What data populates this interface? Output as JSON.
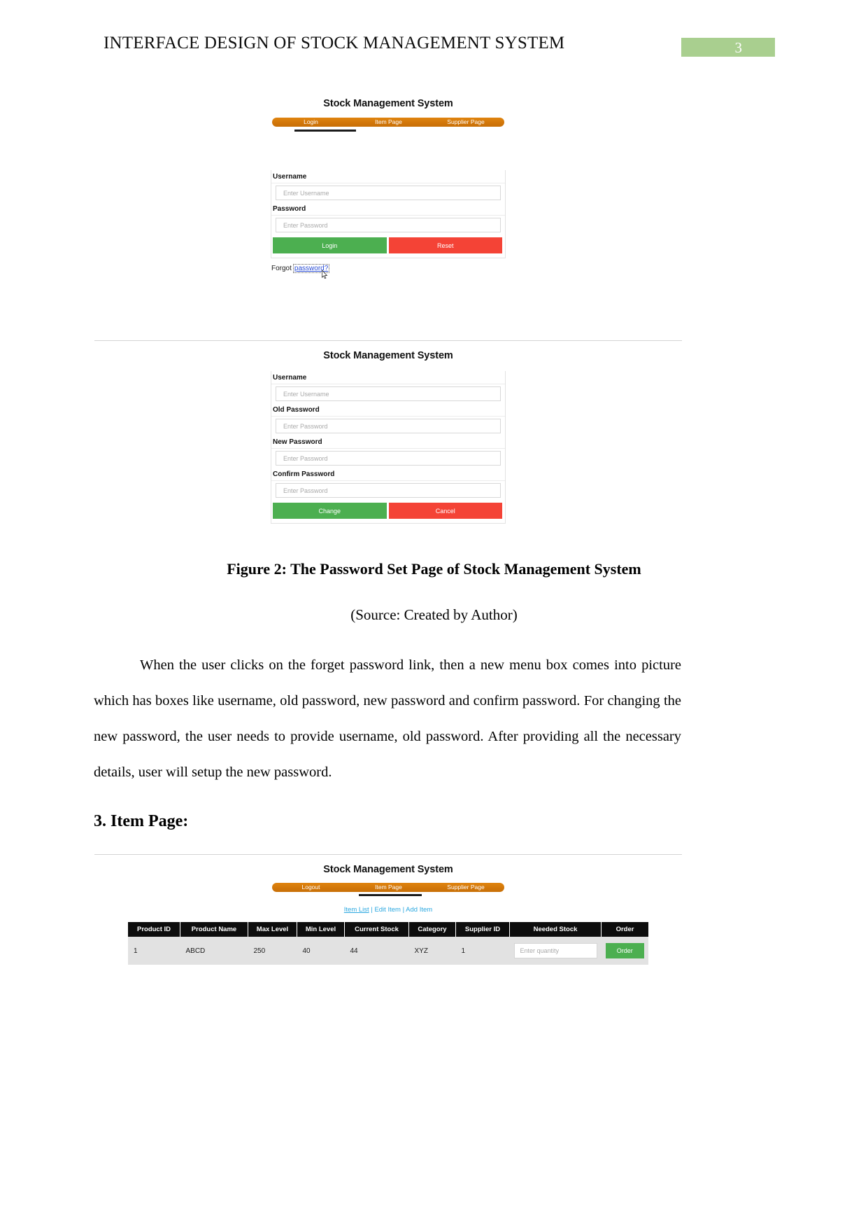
{
  "document": {
    "header_title": "INTERFACE DESIGN OF STOCK MANAGEMENT SYSTEM",
    "page_number": "3"
  },
  "login_mock": {
    "app_title": "Stock Management System",
    "nav": [
      {
        "label": "Login",
        "active": true
      },
      {
        "label": "Item Page",
        "active": false
      },
      {
        "label": "Supplier Page",
        "active": false
      }
    ],
    "fields": [
      {
        "label": "Username",
        "placeholder": "Enter Username"
      },
      {
        "label": "Password",
        "placeholder": "Enter Password"
      }
    ],
    "buttons": [
      {
        "label": "Login",
        "color": "#4caf50"
      },
      {
        "label": "Reset",
        "color": "#f44336"
      }
    ],
    "forgot_prefix": "Forgot",
    "forgot_link": "password?"
  },
  "password_mock": {
    "app_title": "Stock Management System",
    "fields": [
      {
        "label": "Username",
        "placeholder": "Enter Username"
      },
      {
        "label": "Old Password",
        "placeholder": "Enter Password"
      },
      {
        "label": "New Password",
        "placeholder": "Enter Password"
      },
      {
        "label": "Confirm Password",
        "placeholder": "Enter Password"
      }
    ],
    "buttons": [
      {
        "label": "Change",
        "color": "#4caf50"
      },
      {
        "label": "Cancel",
        "color": "#f44336"
      }
    ]
  },
  "figure": {
    "caption": "Figure 2: The Password Set Page of Stock Management System",
    "source": "(Source: Created by Author)"
  },
  "paragraph": {
    "text": "When the user clicks on the forget password link, then a new menu box comes into picture which has boxes like username, old password, new password and confirm password. For changing the new password, the user needs to provide username, old    password. After providing all the necessary details, user will setup the new password."
  },
  "section": {
    "heading": "3. Item Page:"
  },
  "item_mock": {
    "app_title": "Stock Management System",
    "nav": [
      {
        "label": "Logout",
        "active": false
      },
      {
        "label": "Item Page",
        "active": true
      },
      {
        "label": "Supplier Page",
        "active": false
      }
    ],
    "sub_links": [
      {
        "label": "Item List",
        "selected": true
      },
      {
        "label": "Edit Item",
        "selected": false
      },
      {
        "label": "Add Item",
        "selected": false
      }
    ],
    "link_separator": "|",
    "table": {
      "columns": [
        "Product ID",
        "Product Name",
        "Max Level",
        "Min Level",
        "Current Stock",
        "Category",
        "Supplier ID",
        "Needed Stock",
        "Order"
      ],
      "rows": [
        {
          "product_id": "1",
          "product_name": "ABCD",
          "max_level": "250",
          "min_level": "40",
          "current_stock": "44",
          "category": "XYZ",
          "supplier_id": "1",
          "needed_stock_placeholder": "Enter quantity",
          "order_label": "Order"
        }
      ]
    }
  }
}
